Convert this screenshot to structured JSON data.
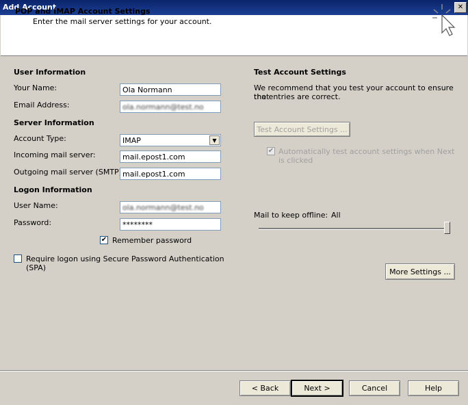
{
  "window": {
    "title": "Add Account",
    "close_glyph": "✕"
  },
  "header": {
    "title": "POP and IMAP Account Settings",
    "subtitle": "Enter the mail server settings for your account."
  },
  "user_info": {
    "section": "User Information",
    "name_label": "Your Name:",
    "name_value": "Ola Normann",
    "email_label": "Email Address:",
    "email_value": "ola.normann@test.no"
  },
  "server_info": {
    "section": "Server Information",
    "account_type_label": "Account Type:",
    "account_type_value": "IMAP",
    "incoming_label": "Incoming mail server:",
    "incoming_value": "mail.epost1.com",
    "outgoing_label": "Outgoing mail server (SMTP):",
    "outgoing_value": "mail.epost1.com"
  },
  "logon_info": {
    "section": "Logon Information",
    "username_label": "User Name:",
    "username_value": "ola.normann@test.no",
    "password_label": "Password:",
    "password_value": "********",
    "remember_label": "Remember password",
    "remember_checked": true,
    "spa_label_line1": "Require logon using Secure Password Authentication",
    "spa_label_line2": "(SPA)",
    "spa_checked": false
  },
  "test_settings": {
    "section": "Test Account Settings",
    "desc_line1": "We recommend that you test your account to ensure that",
    "desc_line2": "the entries are correct.",
    "test_button": "Test Account Settings ...",
    "auto_test_line1": "Automatically test account settings when Next",
    "auto_test_line2": "is clicked",
    "auto_test_checked": true
  },
  "offline": {
    "label": "Mail to keep offline:",
    "value": "All",
    "level": 1.0
  },
  "more_settings_button": "More Settings ...",
  "footer": {
    "back": "< Back",
    "next": "Next >",
    "cancel": "Cancel",
    "help": "Help"
  },
  "icons": {
    "header": "cursor-sparkle-icon",
    "check": "✔",
    "dropdown": "▼"
  }
}
